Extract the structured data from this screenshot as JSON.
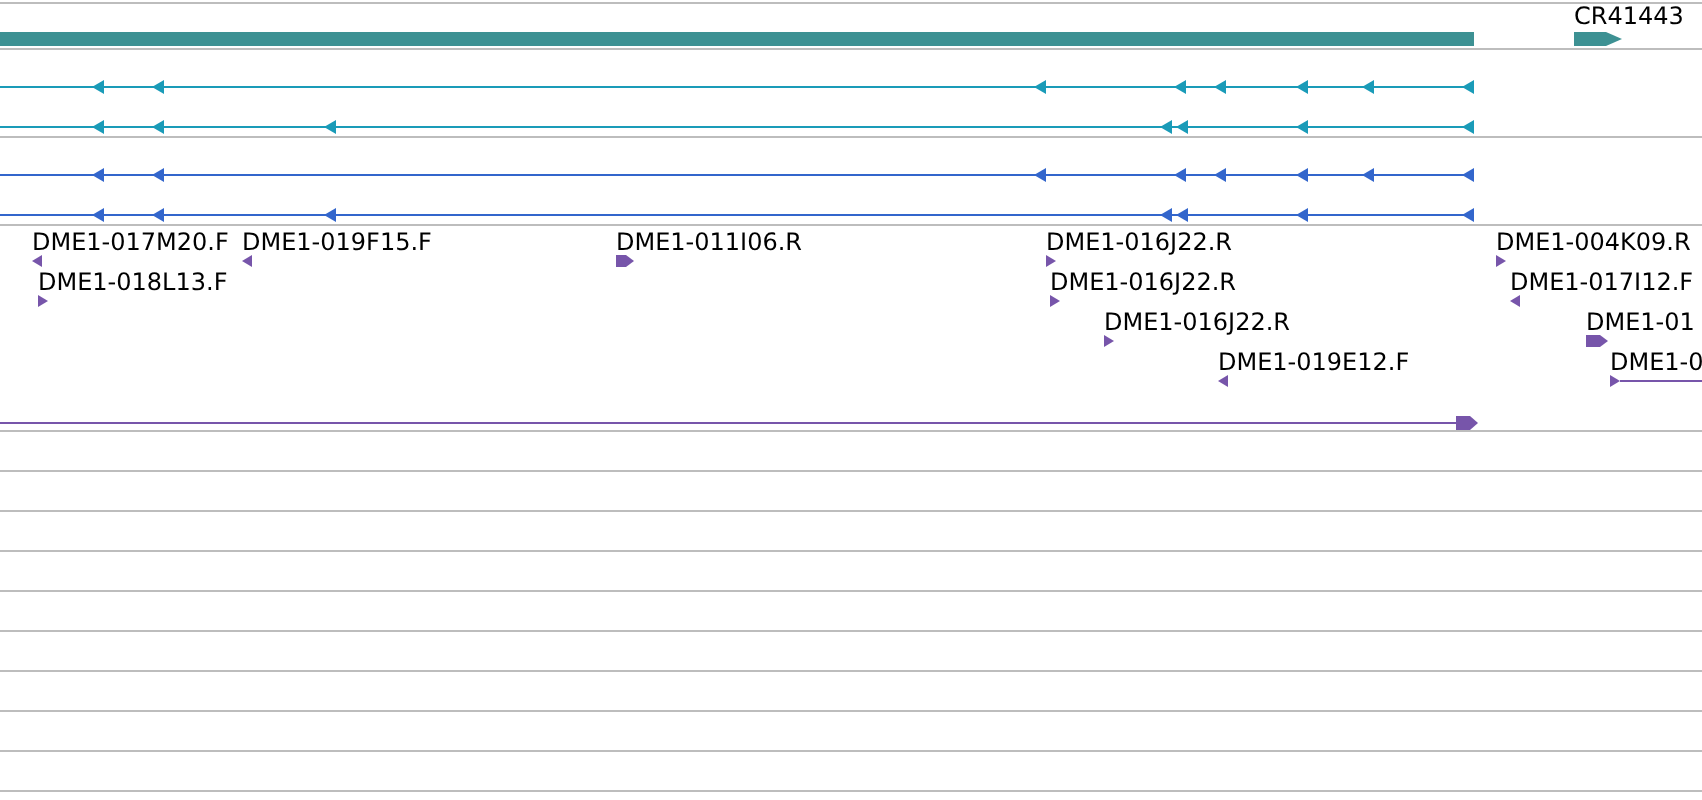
{
  "gene_track": {
    "label": "CR41443"
  },
  "transcripts": [
    {
      "color": "#1a9bb8"
    },
    {
      "color": "#1a9bb8"
    },
    {
      "color": "#3366cc"
    },
    {
      "color": "#3366cc"
    }
  ],
  "clone_ends": [
    {
      "label": "DME1-017M20.F",
      "kind": "reverse"
    },
    {
      "label": "DME1-019F15.F",
      "kind": "reverse"
    },
    {
      "label": "DME1-011I06.R",
      "kind": "forward"
    },
    {
      "label": "DME1-016J22.R",
      "kind": "forward"
    },
    {
      "label": "DME1-004K09.R",
      "kind": "forward"
    },
    {
      "label": "DME1-018L13.F",
      "kind": "forward"
    },
    {
      "label": "DME1-016J22.R",
      "kind": "forward"
    },
    {
      "label": "DME1-017I12.F",
      "kind": "reverse"
    },
    {
      "label": "DME1-016J22.R",
      "kind": "forward"
    },
    {
      "label": "DME1-01",
      "kind": "forward"
    },
    {
      "label": "DME1-019E12.F",
      "kind": "reverse"
    },
    {
      "label": "DME1-0",
      "kind": "forward"
    }
  ]
}
